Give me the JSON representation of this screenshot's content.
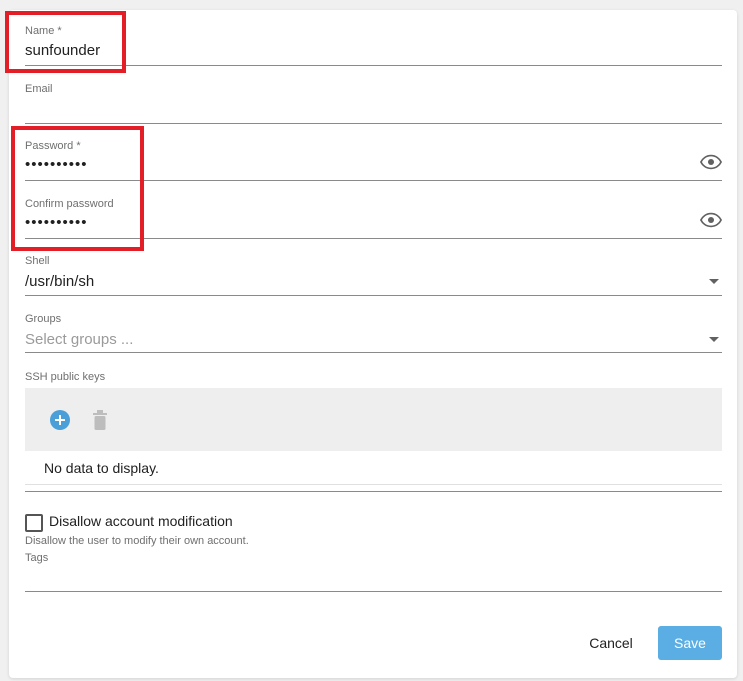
{
  "form": {
    "name": {
      "label": "Name *",
      "value": "sunfounder"
    },
    "email": {
      "label": "Email",
      "value": ""
    },
    "password": {
      "label": "Password *",
      "value": "••••••••••"
    },
    "confirm_password": {
      "label": "Confirm password",
      "value": "••••••••••"
    },
    "shell": {
      "label": "Shell",
      "value": "/usr/bin/sh"
    },
    "groups": {
      "label": "Groups",
      "placeholder": "Select groups ..."
    },
    "ssh_keys": {
      "label": "SSH public keys",
      "empty_text": "No data to display."
    },
    "disallow": {
      "label": "Disallow account modification",
      "hint": "Disallow the user to modify their own account.",
      "checked": false
    },
    "tags": {
      "label": "Tags",
      "value": ""
    }
  },
  "actions": {
    "cancel_label": "Cancel",
    "save_label": "Save"
  },
  "colors": {
    "annotation": "#e41e26",
    "accent": "#4a9fd8",
    "save_button": "#5aaee3"
  }
}
